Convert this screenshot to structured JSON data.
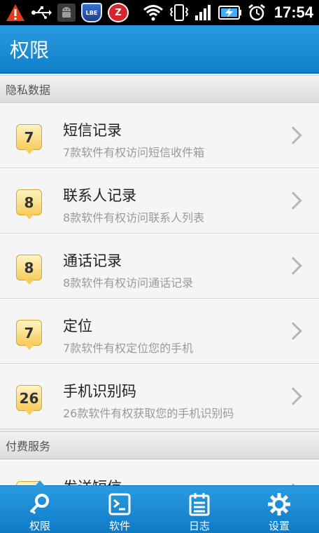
{
  "status_bar": {
    "badge_lbe": "LBE",
    "badge_z": "Z",
    "time": "17:54"
  },
  "header": {
    "title": "权限"
  },
  "sections": [
    {
      "label": "隐私数据"
    },
    {
      "label": "付费服务"
    }
  ],
  "privacy_items": [
    {
      "count": "7",
      "title": "短信记录",
      "subtitle": "7款软件有权访问短信收件箱"
    },
    {
      "count": "8",
      "title": "联系人记录",
      "subtitle": "8款软件有权访问联系人列表"
    },
    {
      "count": "8",
      "title": "通话记录",
      "subtitle": "8款软件有权访问通话记录"
    },
    {
      "count": "7",
      "title": "定位",
      "subtitle": "7款软件有权定位您的手机"
    },
    {
      "count": "26",
      "title": "手机识别码",
      "subtitle": "26款软件有权获取您的手机识别码"
    }
  ],
  "paid_items": [
    {
      "title": "发送短信"
    }
  ],
  "bottom_nav": [
    {
      "label": "权限",
      "icon": "key-icon",
      "active": true
    },
    {
      "label": "软件",
      "icon": "terminal-icon",
      "active": false
    },
    {
      "label": "日志",
      "icon": "log-icon",
      "active": false
    },
    {
      "label": "设置",
      "icon": "gear-icon",
      "active": false
    }
  ],
  "colors": {
    "accent": "#1a8fd8",
    "badge": "#f7cc5a"
  }
}
